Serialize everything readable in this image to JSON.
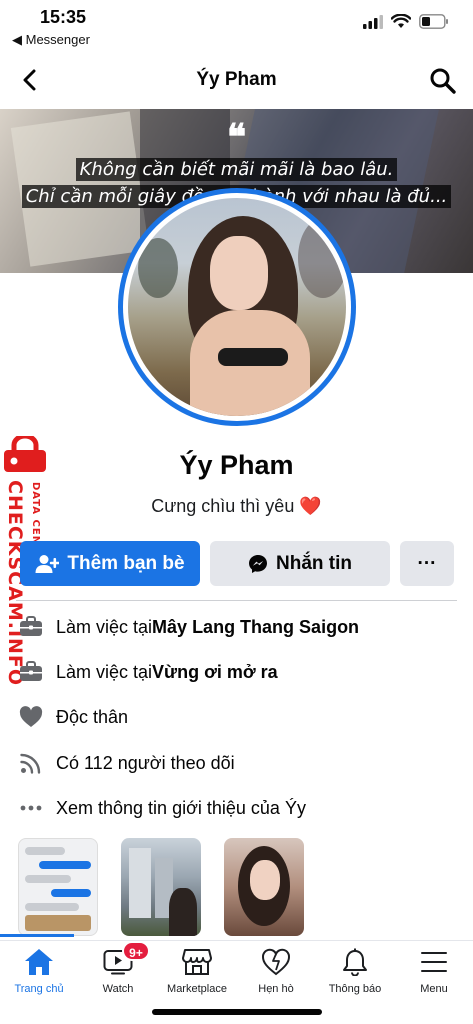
{
  "status_bar": {
    "time": "15:35",
    "back_app": "◀ Messenger"
  },
  "header": {
    "title": "Ýy Pham"
  },
  "cover": {
    "quote_mark": "❝",
    "line1": "Không cần biết mãi mãi là bao lâu.",
    "line2": "Chỉ cần mỗi giây đều ... thành với nhau là đủ..."
  },
  "profile": {
    "name": "Ýy Pham",
    "bio": "Cưng chìu thì yêu",
    "bio_emoji": "❤️"
  },
  "actions": {
    "add_friend": "Thêm bạn bè",
    "message": "Nhắn tin",
    "more": "···"
  },
  "info": [
    {
      "icon": "briefcase-icon",
      "prefix": "Làm việc tại ",
      "bold": "Mây Lang Thang Saigon"
    },
    {
      "icon": "briefcase-icon",
      "prefix": "Làm việc tại ",
      "bold": "Vừng ơi mở ra"
    },
    {
      "icon": "heart-icon",
      "prefix": "Độc thân",
      "bold": ""
    },
    {
      "icon": "rss-icon",
      "prefix": "Có 112 người theo dõi",
      "bold": ""
    },
    {
      "icon": "more-dots-icon",
      "prefix": "Xem thông tin giới thiệu của Ýy",
      "bold": ""
    }
  ],
  "watermark": {
    "text": "CHECKSCAM.INFO",
    "sub": "DATA CENTER"
  },
  "bottom_nav": [
    {
      "label": "Trang chủ",
      "icon": "home-icon",
      "active": true
    },
    {
      "label": "Watch",
      "icon": "watch-icon",
      "badge": "9+"
    },
    {
      "label": "Marketplace",
      "icon": "marketplace-icon"
    },
    {
      "label": "Hẹn hò",
      "icon": "dating-heart-icon"
    },
    {
      "label": "Thông báo",
      "icon": "bell-icon"
    },
    {
      "label": "Menu",
      "icon": "menu-icon"
    }
  ],
  "colors": {
    "accent": "#1b74e4",
    "badge": "#e41e3f",
    "watermark": "#e01e1e"
  }
}
